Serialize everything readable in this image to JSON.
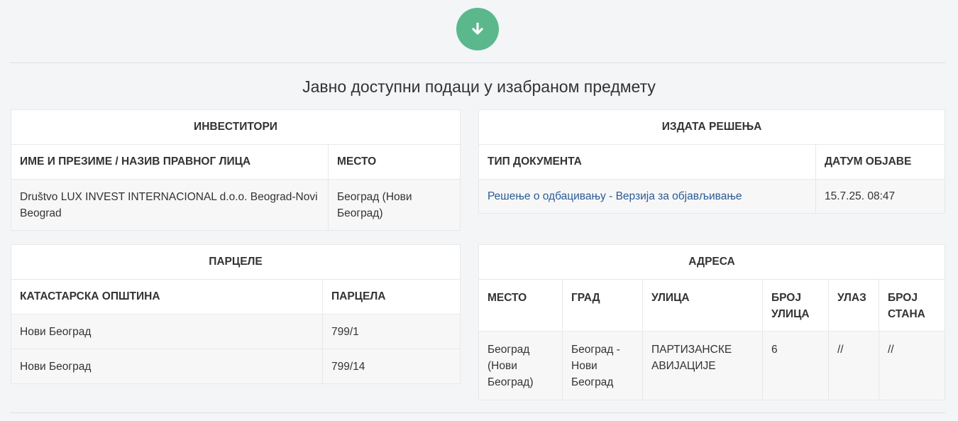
{
  "section": {
    "title": "Јавно доступни подаци у изабраном предмету"
  },
  "download_button": {
    "icon": "arrow-down-icon",
    "color": "#5bb88d"
  },
  "investors": {
    "caption": "ИНВЕСТИТОРИ",
    "columns": [
      "ИМЕ И ПРЕЗИМЕ / НАЗИВ ПРАВНОГ ЛИЦА",
      "МЕСТО"
    ],
    "rows": [
      {
        "name": "Društvo LUX INVEST INTERNACIONAL d.o.o. Beograd-Novi Beograd",
        "place": "Београд (Нови Београд)"
      }
    ]
  },
  "decisions": {
    "caption": "ИЗДАТА РЕШЕЊА",
    "columns": [
      "ТИП ДОКУМЕНТА",
      "ДАТУМ ОБЈАВЕ"
    ],
    "rows": [
      {
        "doc_type": "Решење о одбацивању - Верзија за објављивање",
        "date": "15.7.25. 08:47"
      }
    ],
    "link_color": "#2a5a96"
  },
  "parcels": {
    "caption": "ПАРЦЕЛЕ",
    "columns": [
      "КАТАСТАРСКА ОПШТИНА",
      "ПАРЦЕЛА"
    ],
    "rows": [
      {
        "municipality": "Нови Београд",
        "parcel": "799/1"
      },
      {
        "municipality": "Нови Београд",
        "parcel": "799/14"
      }
    ]
  },
  "address": {
    "caption": "АДРЕСА",
    "columns": [
      "МЕСТО",
      "ГРАД",
      "УЛИЦА",
      "БРОЈ УЛИЦА",
      "УЛАЗ",
      "БРОЈ СТАНА"
    ],
    "rows": [
      {
        "place": "Београд (Нови Београд)",
        "city": "Београд - Нови Београд",
        "street": "ПАРТИЗАНСКЕ АВИЈАЦИЈЕ",
        "street_no": "6",
        "entrance": "//",
        "apartment": "//"
      }
    ]
  }
}
